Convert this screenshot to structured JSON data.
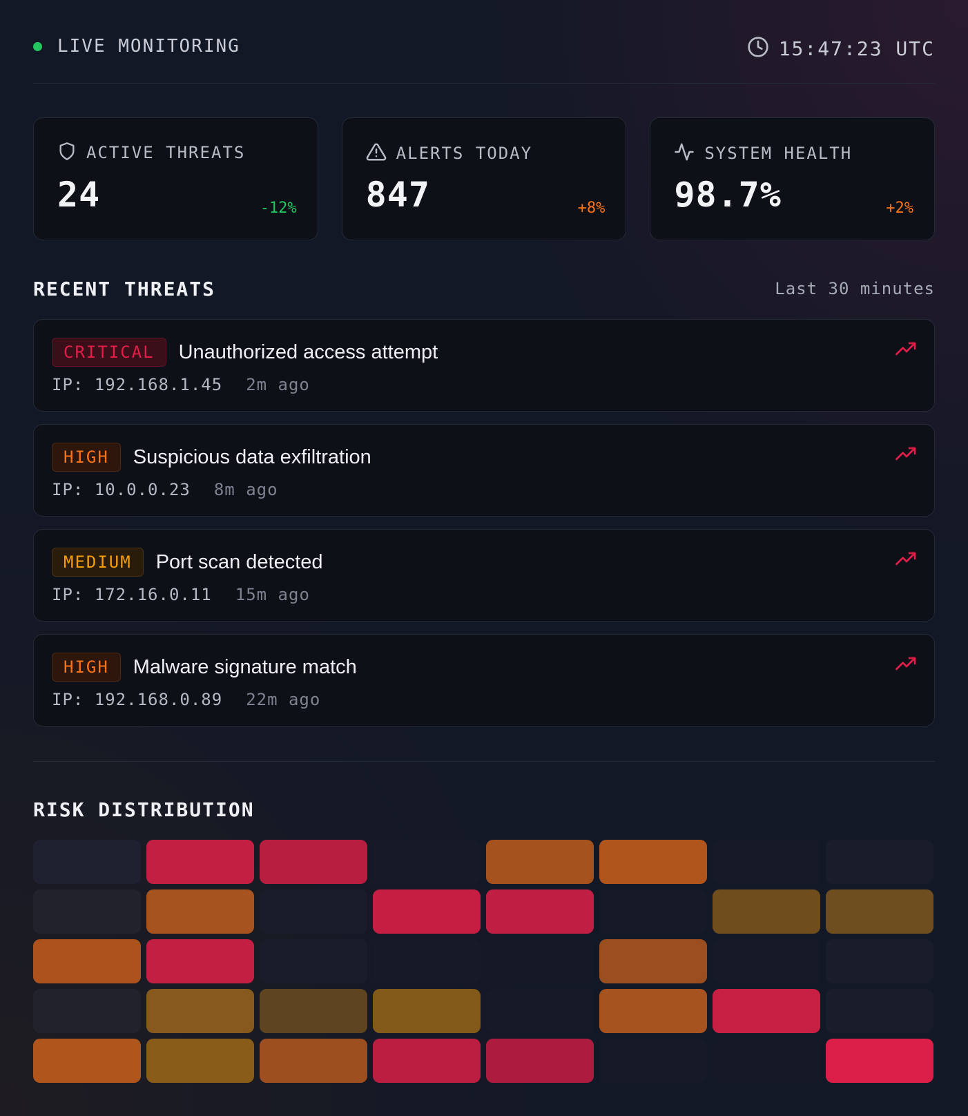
{
  "header": {
    "status_label": "LIVE MONITORING",
    "status_color": "#22c55e",
    "time": "15:47:23 UTC",
    "clock_icon": "clock-icon"
  },
  "stats": [
    {
      "icon": "shield-icon",
      "label": "ACTIVE THREATS",
      "value": "24",
      "delta": "-12%",
      "delta_color": "#22c55e"
    },
    {
      "icon": "alert-triangle-icon",
      "label": "ALERTS TODAY",
      "value": "847",
      "delta": "+8%",
      "delta_color": "#f97316"
    },
    {
      "icon": "activity-icon",
      "label": "SYSTEM HEALTH",
      "value": "98.7%",
      "delta": "+2%",
      "delta_color": "#f97316"
    }
  ],
  "recent": {
    "title": "RECENT THREATS",
    "subtitle": "Last 30 minutes",
    "items": [
      {
        "severity": "CRITICAL",
        "title": "Unauthorized access attempt",
        "ip": "IP: 192.168.1.45",
        "ago": "2m ago",
        "trend_icon": "trending-up-icon"
      },
      {
        "severity": "HIGH",
        "title": "Suspicious data exfiltration",
        "ip": "IP: 10.0.0.23",
        "ago": "8m ago",
        "trend_icon": "trending-up-icon"
      },
      {
        "severity": "MEDIUM",
        "title": "Port scan detected",
        "ip": "IP: 172.16.0.11",
        "ago": "15m ago",
        "trend_icon": "trending-up-icon"
      },
      {
        "severity": "HIGH",
        "title": "Malware signature match",
        "ip": "IP: 192.168.0.89",
        "ago": "22m ago",
        "trend_icon": "trending-up-icon"
      }
    ]
  },
  "risk": {
    "title": "RISK DISTRIBUTION",
    "colors": {
      "none": "#1b1f2b",
      "low": "#5c4620",
      "medium": "#8a5a1a",
      "high": "#b0541d",
      "critical": "#c41e42"
    },
    "rows": [
      [
        "#1f2130",
        "#c21f43",
        "#b81e40",
        "#161a26",
        "#a6521e",
        "#b0561d",
        "#161a26",
        "#191d2a"
      ],
      [
        "#22222c",
        "#a6531f",
        "#191d2a",
        "#c61e42",
        "#c11e43",
        "#161a26",
        "#6f4d1c",
        "#6e4e1e"
      ],
      [
        "#ae521c",
        "#c21f43",
        "#191d2a",
        "#161a26",
        "#151926",
        "#9b4f20",
        "#161a26",
        "#191d2a"
      ],
      [
        "#22222c",
        "#87591c",
        "#5e4520",
        "#845a1a",
        "#161a26",
        "#a6531f",
        "#c81f45",
        "#191d2a"
      ],
      [
        "#b0561c",
        "#8a5c1a",
        "#9d4f20",
        "#bc1e42",
        "#ad1c3e",
        "#161a26",
        "#151926",
        "#db1f48"
      ]
    ]
  }
}
